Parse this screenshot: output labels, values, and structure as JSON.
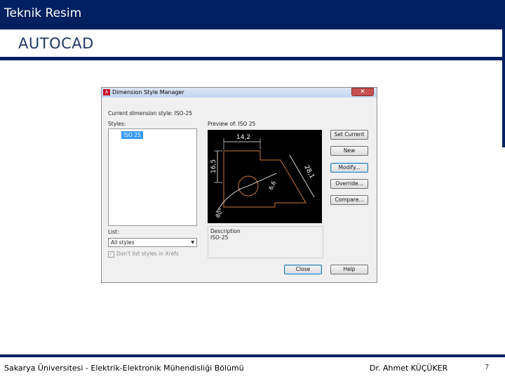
{
  "header": {
    "title": "Teknik Resim",
    "subtitle": "AUTOCAD"
  },
  "dialog": {
    "app_icon": "A",
    "title": "Dimension Style Manager",
    "close_symbol": "✕",
    "current_style_label": "Current dimension style: ISO-25",
    "styles_label": "Styles:",
    "styles": [
      "ISO 25"
    ],
    "preview_label": "Preview of: ISO 25",
    "preview_dimensions": {
      "top": "14,2",
      "left": "16,5",
      "right": "28,1",
      "radius": "6,6",
      "angle": "80°"
    },
    "description_label": "Description",
    "description_value": "ISO-25",
    "list_label": "List:",
    "list_value": "All styles",
    "dropdown_arrow": "▼",
    "checkbox_label": "Don't list styles in Xrefs",
    "checkbox_checked": true,
    "buttons": {
      "set_current": "Set Current",
      "new": "New",
      "modify": "Modify...",
      "override": "Override...",
      "compare": "Compare...",
      "close": "Close",
      "help": "Help"
    }
  },
  "footer": {
    "university": "Sakarya Üniversitesi - Elektrik-Elektronik Mühendisliği Bölümü",
    "author": "Dr. Ahmet KÜÇÜKER",
    "page": "7"
  },
  "colors": {
    "brand_navy": "#002060",
    "preview_background": "#000000",
    "preview_geometry": "#c8783c",
    "preview_dimension": "#ffffff",
    "selection": "#3399ff"
  }
}
